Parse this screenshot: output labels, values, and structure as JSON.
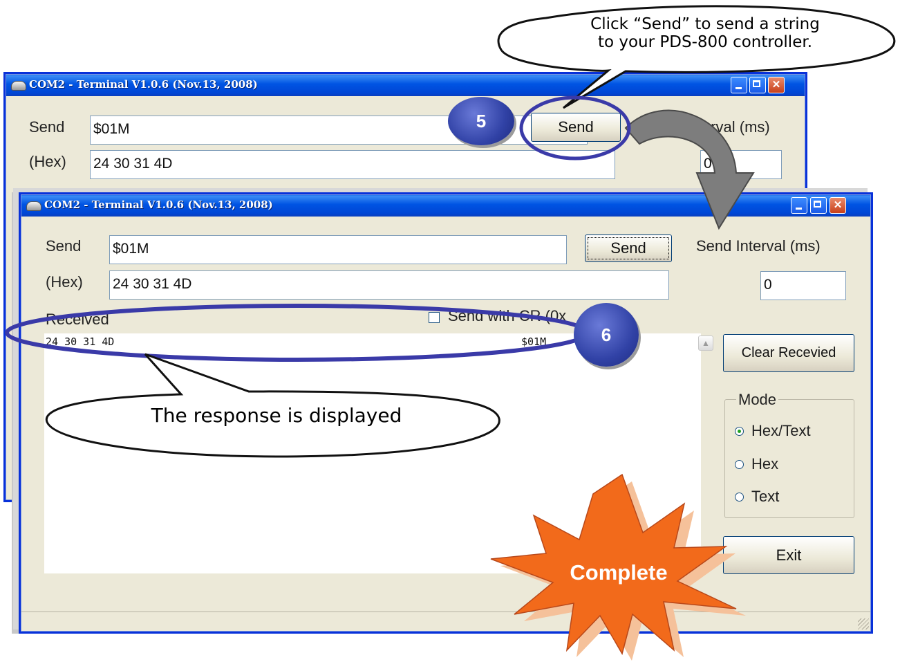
{
  "back_window": {
    "title": "COM2 - Terminal V1.0.6 (Nov.13, 2008)",
    "send_label": "Send",
    "hex_label": "(Hex)",
    "send_value": "$01M",
    "hex_value": "24 30 31 4D",
    "send_button": "Send",
    "interval_label": "Send Interval (ms)",
    "interval_value": "0"
  },
  "front_window": {
    "title": "COM2 - Terminal V1.0.6 (Nov.13, 2008)",
    "send_label": "Send",
    "hex_label": "(Hex)",
    "send_value": "$01M",
    "hex_value": "24 30 31 4D",
    "send_button": "Send",
    "interval_label": "Send Interval (ms)",
    "interval_value": "0",
    "received_label": "Received",
    "send_with_cr_label": "Send with CR (0x",
    "received_lines": [
      {
        "hex": "24 30 31 4D",
        "text": "$01M"
      }
    ],
    "clear_button": "Clear Recevied",
    "mode": {
      "title": "Mode",
      "options": [
        "Hex/Text",
        "Hex",
        "Text"
      ],
      "selected": "Hex/Text"
    },
    "exit_button": "Exit"
  },
  "annotations": {
    "callout_send": "Click “Send” to send a string to your PDS-800 controller.",
    "callout_send_line1": "Click “Send” to send a string",
    "callout_send_line2": "to your PDS-800 controller.",
    "step5": "5",
    "step6": "6",
    "callout_response": "The response is displayed",
    "complete": "Complete",
    "colors": {
      "badge": "#3142a6",
      "burst": "#f26a1b",
      "highlight_ring": "#3a3aa8"
    }
  }
}
